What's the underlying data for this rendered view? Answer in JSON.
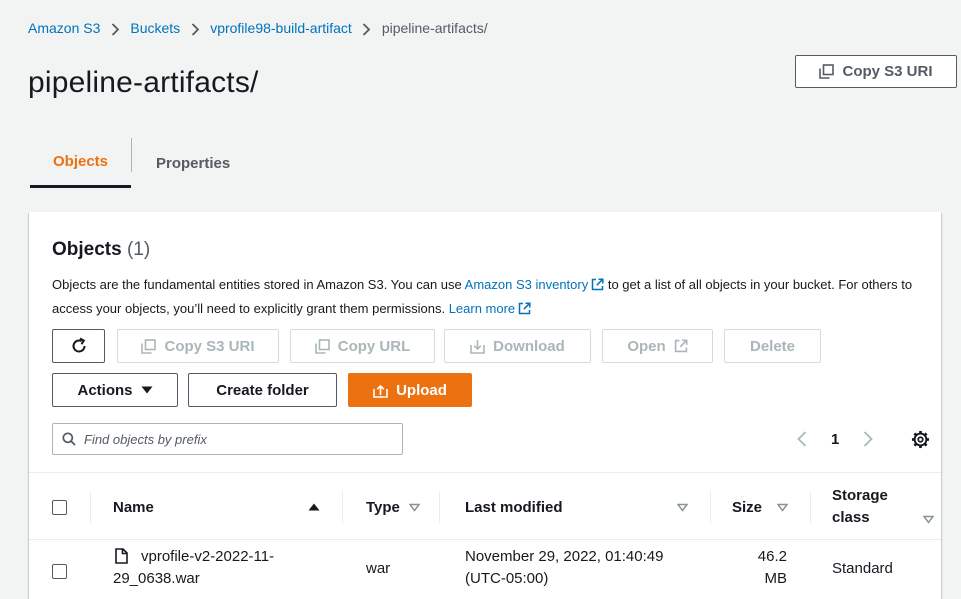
{
  "breadcrumb": {
    "items": [
      "Amazon S3",
      "Buckets",
      "vprofile98-build-artifact",
      "pipeline-artifacts/"
    ]
  },
  "page": {
    "title": "pipeline-artifacts/",
    "copy_uri_label": "Copy S3 URI"
  },
  "tabs": [
    {
      "label": "Objects",
      "active": true
    },
    {
      "label": "Properties",
      "active": false
    }
  ],
  "objects_panel": {
    "title": "Objects",
    "count": "(1)",
    "desc_part1": "Objects are the fundamental entities stored in Amazon S3. You can use ",
    "desc_link1": "Amazon S3 inventory",
    "desc_part2": " to get a list of all objects in your bucket. For others to access your objects, you’ll need to explicitly grant them permissions. ",
    "desc_link2": "Learn more"
  },
  "toolbar": {
    "copy_s3_uri": "Copy S3 URI",
    "copy_url": "Copy URL",
    "download": "Download",
    "open": "Open",
    "delete": "Delete",
    "actions": "Actions",
    "create_folder": "Create folder",
    "upload": "Upload"
  },
  "search": {
    "placeholder": "Find objects by prefix",
    "value": ""
  },
  "pagination": {
    "current_page": "1"
  },
  "table": {
    "columns": [
      "Name",
      "Type",
      "Last modified",
      "Size",
      "Storage class"
    ],
    "rows": [
      {
        "name_line1": "vprofile-v2-2022-11-",
        "name_line2": "29_0638.war",
        "type": "war",
        "last_modified_line1": "November 29, 2022, 01:40:49",
        "last_modified_line2": "(UTC-05:00)",
        "size_line1": "46.2",
        "size_line2": "MB",
        "storage_class": "Standard"
      }
    ]
  },
  "colors": {
    "accent_orange": "#ec7211",
    "link_blue": "#0073bb",
    "text_dark": "#16191f",
    "text_gray": "#545b64",
    "disabled_gray": "#aab7b8",
    "background": "#f2f3f3"
  },
  "icons": {
    "copy": "copy-icon",
    "refresh": "refresh-icon",
    "download": "download-icon",
    "external": "external-link-icon",
    "upload": "upload-icon",
    "search": "search-icon",
    "settings": "gear-icon",
    "file": "file-icon",
    "sort": "sort-caret-icon"
  }
}
